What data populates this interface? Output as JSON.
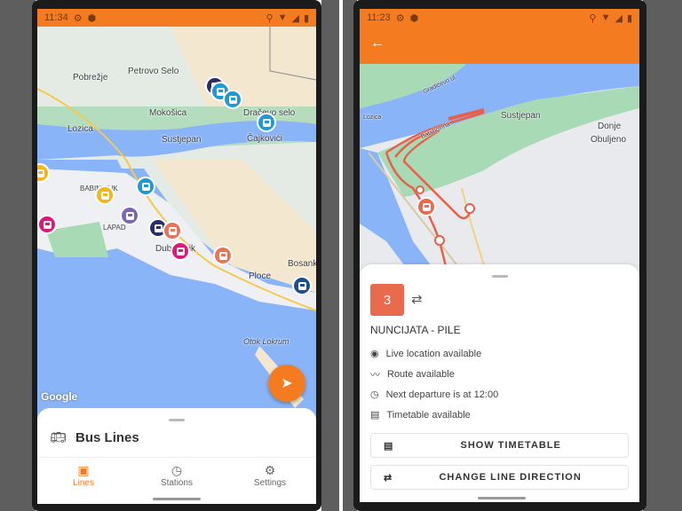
{
  "colors": {
    "accent": "#f47b20",
    "route": "#e8604a",
    "water": "#8ab4f8",
    "park": "#a8dab5"
  },
  "left_screen": {
    "status": {
      "time": "11:34",
      "icons": [
        "gear-icon",
        "shield-icon",
        "location-icon",
        "wifi-icon",
        "signal-icon",
        "battery-icon"
      ]
    },
    "map_labels": [
      "Pobrežje",
      "Petrovo Selo",
      "Mokošica",
      "Dračevo selo",
      "Lozica",
      "Sustjepan",
      "Čajkovići",
      "BABIN KUK",
      "LAPAD",
      "Dubrovnik",
      "Ploce",
      "Bosanka",
      "Otok Lokrum"
    ],
    "map_attribution": "Google",
    "markers": [
      {
        "color": "#2b2c6b"
      },
      {
        "color": "#1e9bd7"
      },
      {
        "color": "#1e9bd7"
      },
      {
        "color": "#1e9bd7"
      },
      {
        "color": "#f2b71c"
      },
      {
        "color": "#1e9bd7"
      },
      {
        "color": "#f2b71c"
      },
      {
        "color": "#7b68b0"
      },
      {
        "color": "#d81b7a"
      },
      {
        "color": "#2b2c6b"
      },
      {
        "color": "#ea7358"
      },
      {
        "color": "#d81b7a"
      },
      {
        "color": "#ea7358"
      },
      {
        "color": "#1d4f8c"
      }
    ],
    "fab_icon": "navigation-arrow-icon",
    "sheet": {
      "title": "Bus Lines",
      "title_icon": "bus-icon"
    },
    "nav": [
      {
        "label": "Lines",
        "icon": "bus-icon",
        "active": true
      },
      {
        "label": "Stations",
        "icon": "bus-clock-icon",
        "active": false
      },
      {
        "label": "Settings",
        "icon": "gear-icon",
        "active": false
      }
    ]
  },
  "right_screen": {
    "status": {
      "time": "11:23"
    },
    "back_icon": "arrow-back-icon",
    "map_labels": [
      "Sustjepan",
      "Donje",
      "Obuljeno",
      "Lozica",
      "Gradićevo ul.",
      "Batahovina"
    ],
    "line": {
      "number": "3",
      "color": "#ea6a4d",
      "name": "NUNCIJATA - PILE"
    },
    "features": [
      {
        "icon": "live-location-icon",
        "text": "Live location available"
      },
      {
        "icon": "route-icon",
        "text": "Route available"
      },
      {
        "icon": "clock-icon",
        "text": "Next departure is at 12:00"
      },
      {
        "icon": "timetable-icon",
        "text": "Timetable available"
      }
    ],
    "buttons": {
      "show_timetable": "SHOW TIMETABLE",
      "change_direction": "CHANGE LINE DIRECTION"
    }
  }
}
